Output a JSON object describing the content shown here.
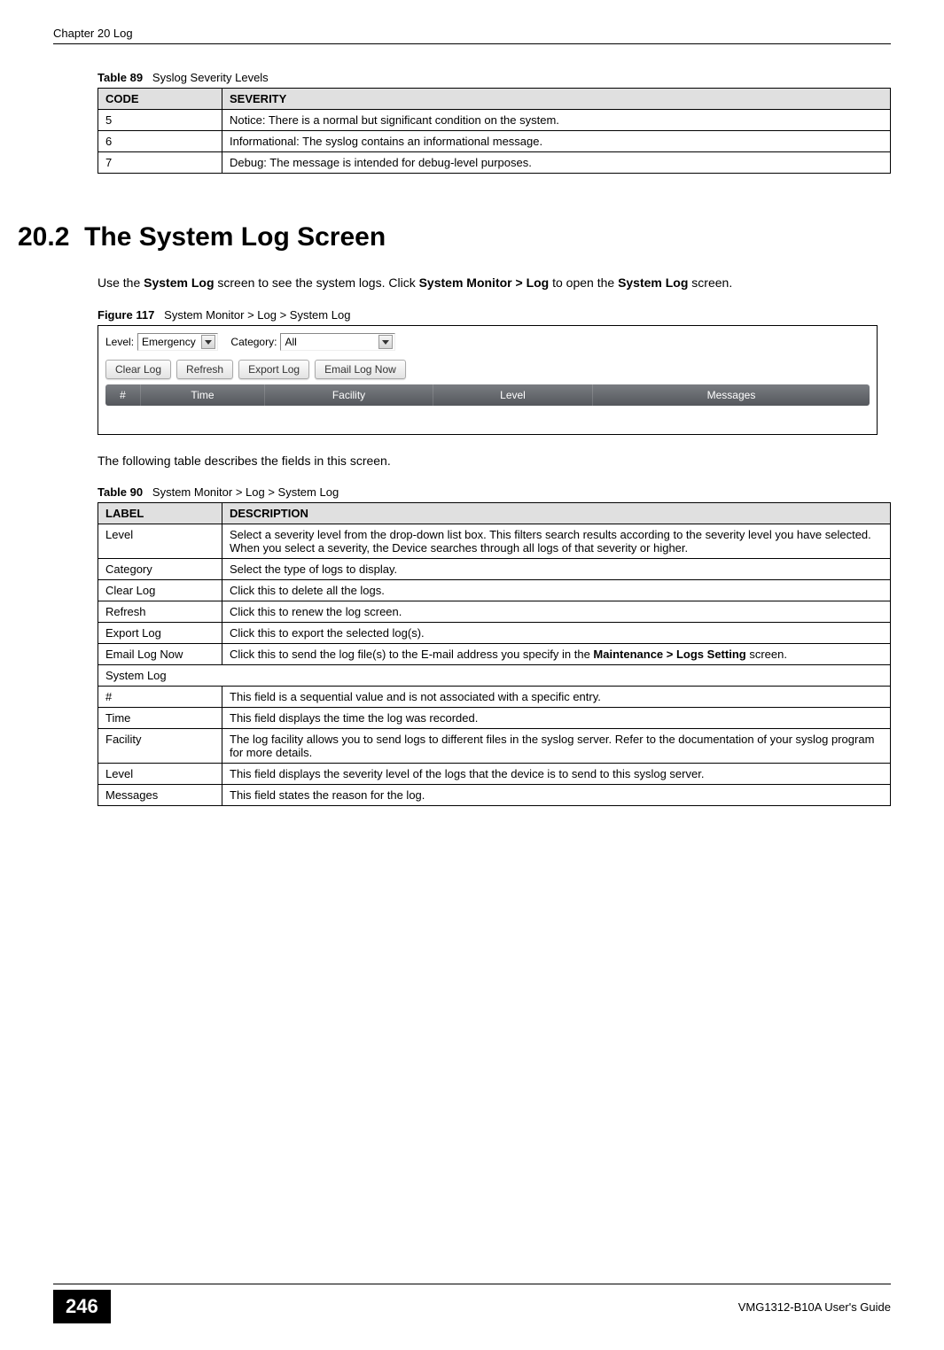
{
  "header": {
    "chapter": "Chapter 20 Log"
  },
  "table89": {
    "caption_label": "Table 89",
    "caption_text": "Syslog Severity Levels",
    "headers": {
      "code": "CODE",
      "severity": "SEVERITY"
    },
    "rows": [
      {
        "code": "5",
        "severity": "Notice: There is a normal but significant condition on the system."
      },
      {
        "code": "6",
        "severity": "Informational: The syslog contains an informational message."
      },
      {
        "code": "7",
        "severity": "Debug: The message is intended for debug-level purposes."
      }
    ]
  },
  "section": {
    "number": "20.2",
    "title": "The System Log Screen",
    "para1_pre": "Use the ",
    "para1_b1": "System Log",
    "para1_mid1": " screen to see the system logs. Click ",
    "para1_b2": "System Monitor > Log",
    "para1_mid2": " to open the ",
    "para1_b3": "System Log",
    "para1_post": " screen."
  },
  "figure": {
    "caption_label": "Figure 117",
    "caption_text": "System Monitor > Log > System Log",
    "labels": {
      "level": "Level:",
      "category": "Category:",
      "level_value": "Emergency",
      "category_value": "All"
    },
    "buttons": {
      "clear": "Clear Log",
      "refresh": "Refresh",
      "export": "Export Log",
      "email": "Email Log Now"
    },
    "columns": {
      "hash": "#",
      "time": "Time",
      "facility": "Facility",
      "level": "Level",
      "messages": "Messages"
    }
  },
  "para2": "The following table describes the fields in this screen.",
  "table90": {
    "caption_label": "Table 90",
    "caption_text": "System Monitor > Log > System Log",
    "headers": {
      "label": "LABEL",
      "desc": "DESCRIPTION"
    },
    "rows": [
      {
        "label": "Level",
        "desc": "Select a severity level from the drop-down list box. This filters search results according to the severity level you have selected. When you select a severity, the Device searches through all logs of that severity or higher."
      },
      {
        "label": "Category",
        "desc": "Select the type of logs to display."
      },
      {
        "label": "Clear Log",
        "desc": "Click this to delete all the logs."
      },
      {
        "label": "Refresh",
        "desc": "Click this to renew the log screen."
      },
      {
        "label": "Export Log",
        "desc": "Click this to export the selected log(s)."
      }
    ],
    "email_row": {
      "label": "Email Log Now",
      "pre": "Click this to send the log file(s) to the E-mail address you specify in the ",
      "bold": "Maintenance > Logs Setting",
      "post": " screen."
    },
    "span_row": "System Log",
    "rows2": [
      {
        "label": "#",
        "desc": "This field is a sequential value and is not associated with a specific entry."
      },
      {
        "label": "Time",
        "desc": "This field displays the time the log was recorded."
      },
      {
        "label": "Facility",
        "desc": "The log facility allows you to send logs to different files in the syslog server. Refer to the documentation of your syslog program for more details."
      },
      {
        "label": "Level",
        "desc": "This field displays the severity level of the logs that the device is to send to this syslog server."
      },
      {
        "label": "Messages",
        "desc": "This field states the reason for the log."
      }
    ]
  },
  "footer": {
    "page": "246",
    "guide": "VMG1312-B10A User's Guide"
  }
}
